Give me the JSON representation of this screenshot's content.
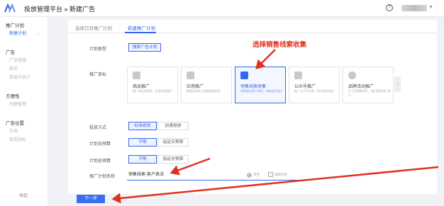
{
  "header": {
    "app_title": "投放管理平台 » 新建广告",
    "help_symbol": "?",
    "caret_symbol": "▼"
  },
  "sidebar": {
    "group_plan": "推广计划",
    "item_new_plan": "新建计划",
    "group_ads": "广告",
    "item_ad_manage": "广告管理",
    "item_report": "报告",
    "item_data_stats": "数据与统计",
    "group_tools": "方便性",
    "item_asset_center": "创建管理",
    "group_ad_unit": "广告位置",
    "item_monitor": "包装",
    "item_conversion": "智能指标",
    "more_symbol": "···",
    "collapse_label": "收起"
  },
  "tabs": [
    {
      "label": "选择已有推广计划"
    },
    {
      "label": "新建推广计划"
    }
  ],
  "form": {
    "plan_type": {
      "label": "计划类型",
      "value": "搜索广告计划"
    },
    "goal": {
      "label": "推广目标",
      "cards": [
        {
          "title": "商品推广",
          "desc": "推广商品的商品、标签优质客户"
        },
        {
          "title": "应用推广",
          "desc": "提高应用的下载量和使用率"
        },
        {
          "title": "销售线索收集",
          "desc": "收集潜在客户线索，带来更多客户"
        },
        {
          "title": "公众号推广",
          "desc": "推广公众号文章，吸引更多粉丝"
        },
        {
          "title": "品牌活动推广",
          "desc": "扩大品牌影响力，吸引更多用户参与"
        }
      ],
      "nav_symbol": "›"
    },
    "delivery_mode": {
      "label": "投放方式",
      "options": [
        "标准投放",
        "加速投放"
      ]
    },
    "daily_budget": {
      "label": "计划日预算",
      "options": [
        "不限",
        "指定日预算"
      ]
    },
    "total_budget": {
      "label": "计划总预算",
      "options": [
        "不限",
        "指定总预算"
      ]
    },
    "plan_name": {
      "label": "推广计划名称",
      "value": "销售线索-客户表活",
      "clear_symbol": "×",
      "hint1": "清空",
      "edit_symbol": "✎",
      "hint2": "编辑名称"
    }
  },
  "actions": {
    "next_label": "下一步"
  },
  "annotation": {
    "text": "选择销售线索收集",
    "color": "#e03020"
  },
  "colors": {
    "accent": "#3468f0",
    "annotation": "#e03020"
  }
}
